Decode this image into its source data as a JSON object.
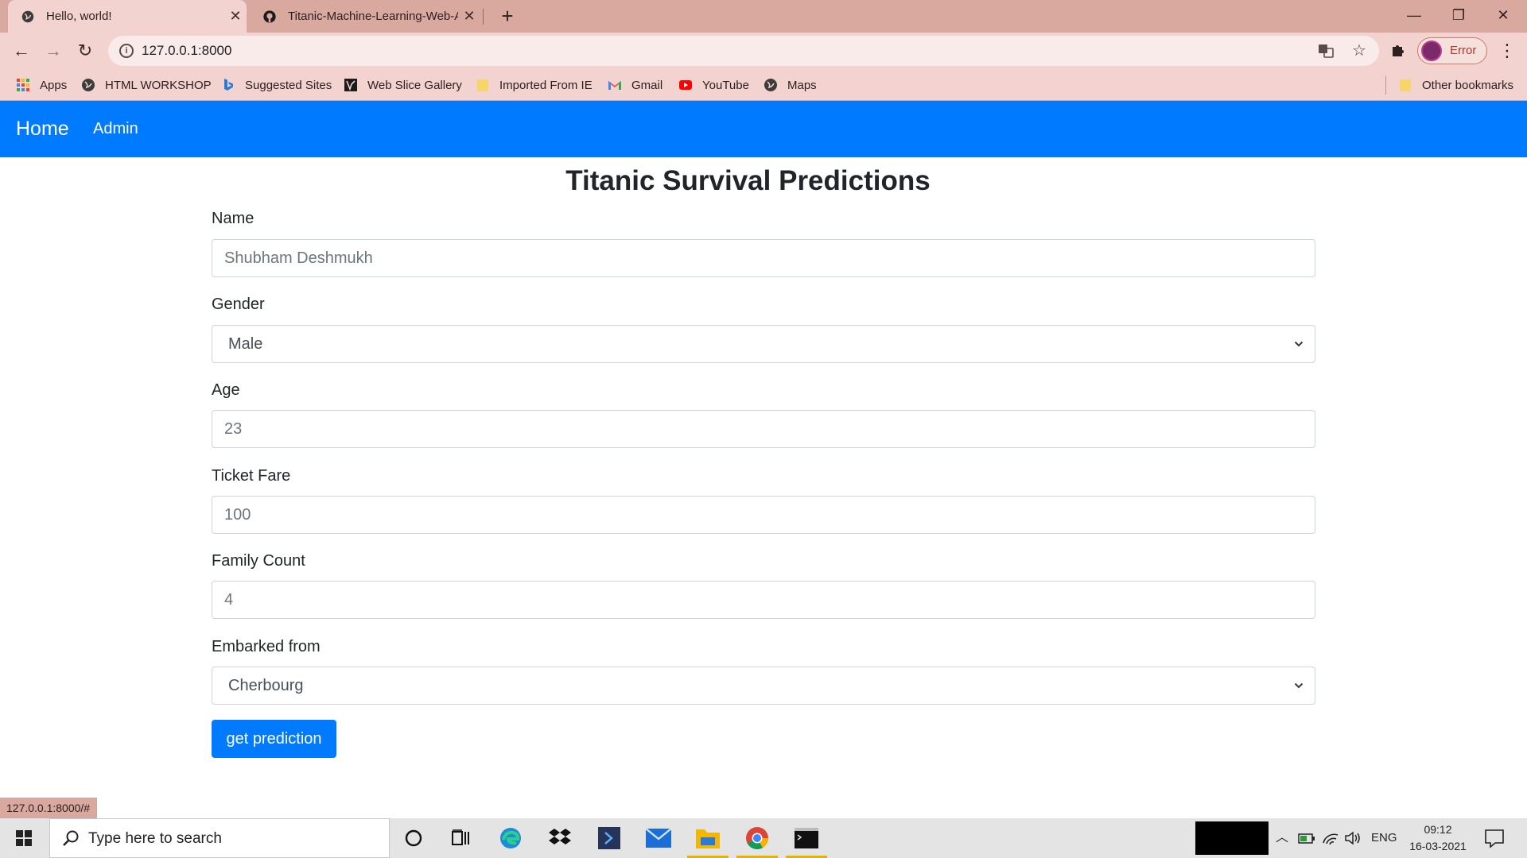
{
  "browser": {
    "tabs": [
      {
        "title": "Hello, world!",
        "active": true
      },
      {
        "title": "Titanic-Machine-Learning-Web-A",
        "active": false
      }
    ],
    "url": "127.0.0.1:8000",
    "profile_label": "Error",
    "bookmarks": [
      {
        "label": "Apps",
        "icon": "apps-grid-icon"
      },
      {
        "label": "HTML WORKSHOP",
        "icon": "globe-icon"
      },
      {
        "label": "Suggested Sites",
        "icon": "bing-icon"
      },
      {
        "label": "Web Slice Gallery",
        "icon": "web-slice-icon"
      },
      {
        "label": "Imported From IE",
        "icon": "folder-icon"
      },
      {
        "label": "Gmail",
        "icon": "gmail-icon"
      },
      {
        "label": "YouTube",
        "icon": "youtube-icon"
      },
      {
        "label": "Maps",
        "icon": "globe-icon"
      }
    ],
    "other_bookmarks": "Other bookmarks",
    "status_url": "127.0.0.1:8000/#"
  },
  "navbar": {
    "brand": "Home",
    "links": [
      "Admin"
    ]
  },
  "form": {
    "title": "Titanic Survival Predictions",
    "fields": {
      "name": {
        "label": "Name",
        "placeholder": "Shubham Deshmukh"
      },
      "gender": {
        "label": "Gender",
        "selected": "Male"
      },
      "age": {
        "label": "Age",
        "placeholder": "23"
      },
      "fare": {
        "label": "Ticket Fare",
        "placeholder": "100"
      },
      "family": {
        "label": "Family Count",
        "placeholder": "4"
      },
      "embarked": {
        "label": "Embarked from",
        "selected": "Cherbourg"
      }
    },
    "submit_label": "get prediction"
  },
  "taskbar": {
    "search_placeholder": "Type here to search",
    "language": "ENG",
    "time": "09:12",
    "date": "16-03-2021"
  },
  "colors": {
    "navbar": "#007bff",
    "tabstrip": "#d9a9a0",
    "toolbar": "#f2d3cf",
    "button": "#007bff"
  }
}
